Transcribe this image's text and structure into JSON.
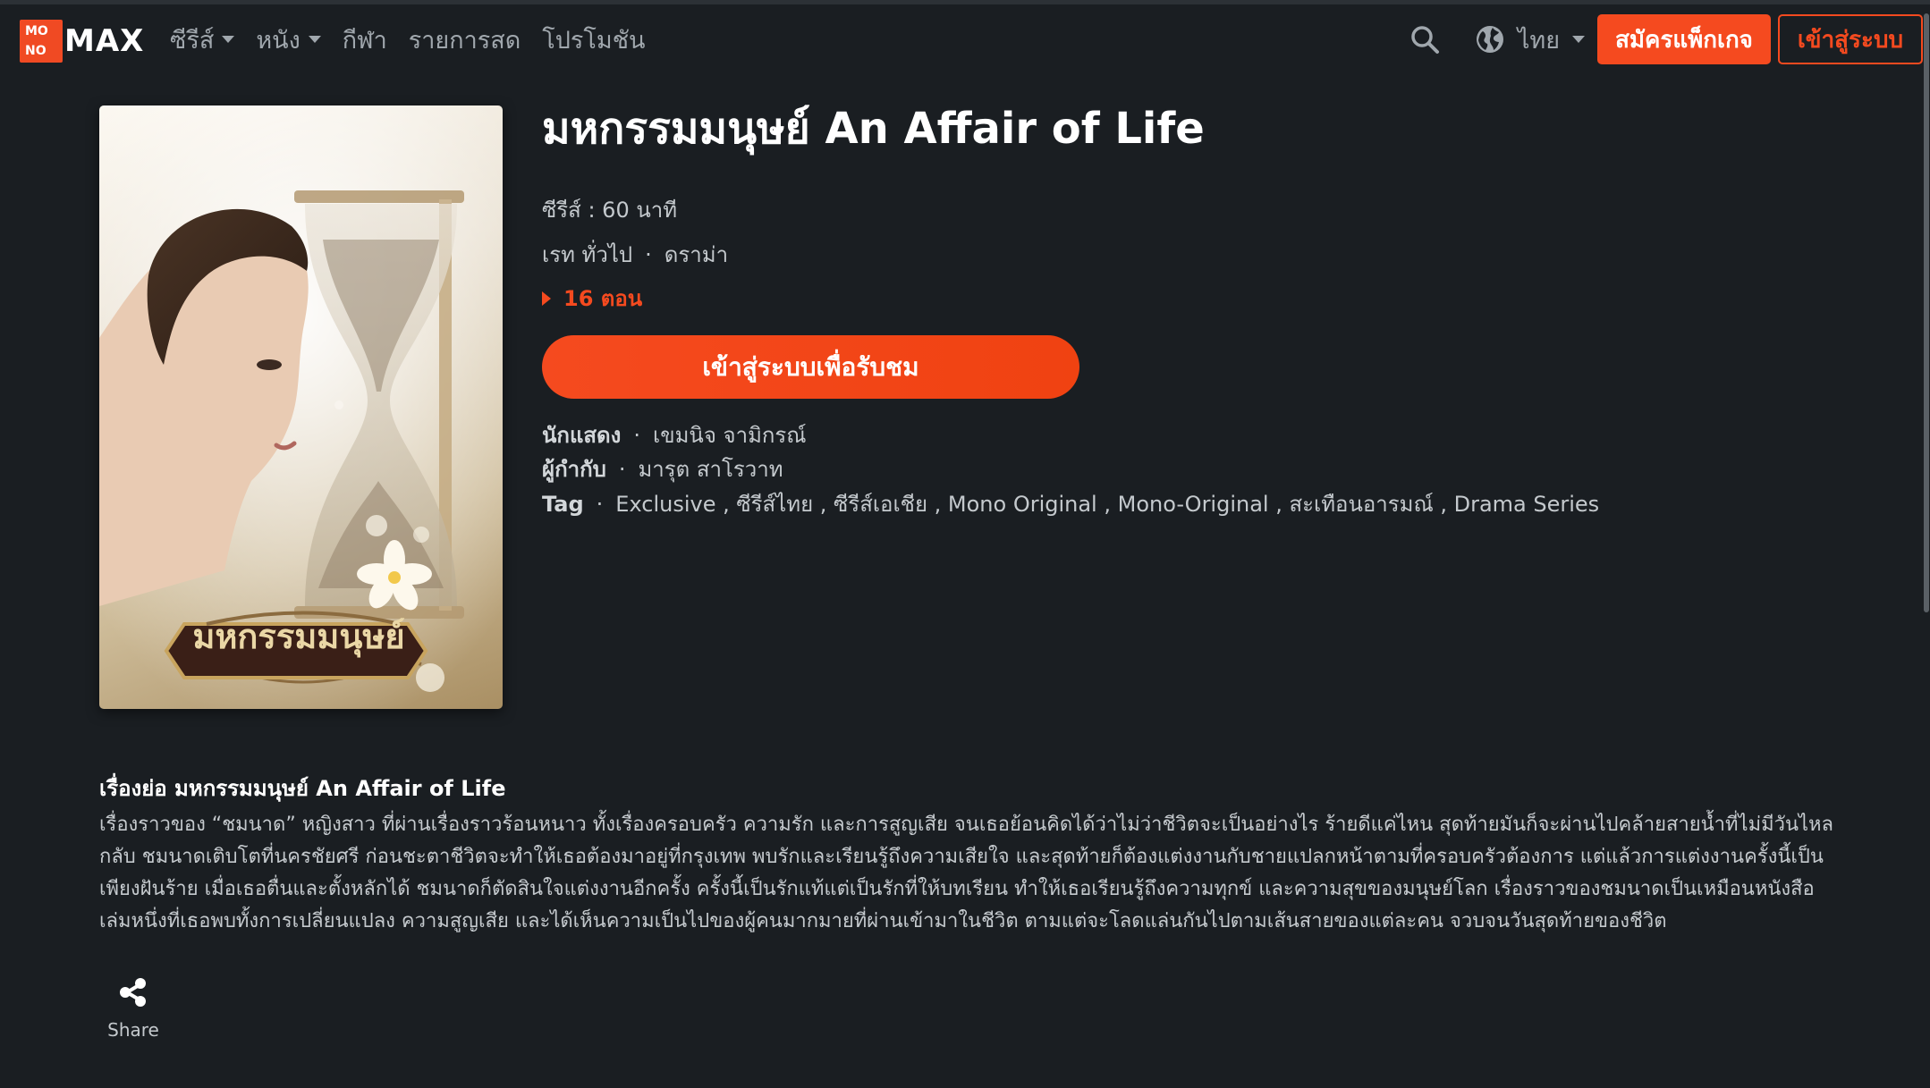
{
  "brand": {
    "mono_line1": "MO",
    "mono_line2": "NO",
    "name": "MAX"
  },
  "nav": {
    "items": [
      {
        "label": "ซีรีส์",
        "has_dropdown": true
      },
      {
        "label": "หนัง",
        "has_dropdown": true
      },
      {
        "label": "กีฬา",
        "has_dropdown": false
      },
      {
        "label": "รายการสด",
        "has_dropdown": false
      },
      {
        "label": "โปรโมชัน",
        "has_dropdown": false
      }
    ],
    "search_icon": "search-icon",
    "language": "ไทย",
    "register_label": "สมัครแพ็กเกจ",
    "login_label": "เข้าสู่ระบบ"
  },
  "poster": {
    "title_text": "มหกรรมมนุษย์"
  },
  "show": {
    "title": "มหกรรมมนุษย์ An Affair of Life",
    "type_duration": "ซีรีส์ : 60 นาที",
    "rating": "เรท ทั่วไป",
    "genre": "ดราม่า",
    "episodes": "16 ตอน",
    "watch_label": "เข้าสู่ระบบเพื่อรับชม",
    "cast_label": "นักแสดง",
    "cast": "เขมนิจ จามิกรณ์",
    "director_label": "ผู้กำกับ",
    "director": "มารุต สาโรวาท",
    "tag_label": "Tag",
    "tags": "Exclusive , ซีรีส์ไทย , ซีรีส์เอเชีย , Mono Original , Mono-Original , สะเทือนอารมณ์ , Drama Series"
  },
  "synopsis": {
    "title": "เรื่องย่อ มหกรรมมนุษย์ An Affair of Life",
    "text": "เรื่องราวของ “ชมนาด” หญิงสาว ที่ผ่านเรื่องราวร้อนหนาว ทั้งเรื่องครอบครัว ความรัก และการสูญเสีย จนเธอย้อนคิดได้ว่าไม่ว่าชีวิตจะเป็นอย่างไร ร้ายดีแค่ไหน สุดท้ายมันก็จะผ่านไปคล้ายสายน้ำที่ไม่มีวันไหลกลับ ชมนาดเติบโตที่นครชัยศรี ก่อนชะตาชีวิตจะทำให้เธอต้องมาอยู่ที่กรุงเทพ พบรักและเรียนรู้ถึงความเสียใจ และสุดท้ายก็ต้องแต่งงานกับชายแปลกหน้าตามที่ครอบครัวต้องการ แต่แล้วการแต่งงานครั้งนี้เป็นเพียงฝันร้าย เมื่อเธอตื่นและตั้งหลักได้ ชมนาดก็ตัดสินใจแต่งงานอีกครั้ง ครั้งนี้เป็นรักแท้แต่เป็นรักที่ให้บทเรียน ทำให้เธอเรียนรู้ถึงความทุกข์ และความสุขของมนุษย์โลก เรื่องราวของชมนาดเป็นเหมือนหนังสือเล่มหนึ่งที่เธอพบทั้งการเปลี่ยนแปลง ความสูญเสีย และได้เห็นความเป็นไปของผู้คนมากมายที่ผ่านเข้ามาในชีวิต ตามแต่จะโลดแล่นกันไปตามเส้นสายของแต่ละคน จวบจนวันสุดท้ายของชีวิต"
  },
  "share": {
    "label": "Share"
  },
  "colors": {
    "accent": "#f54a1f",
    "background": "#1a1e22",
    "muted_text": "#a0a7ad"
  }
}
